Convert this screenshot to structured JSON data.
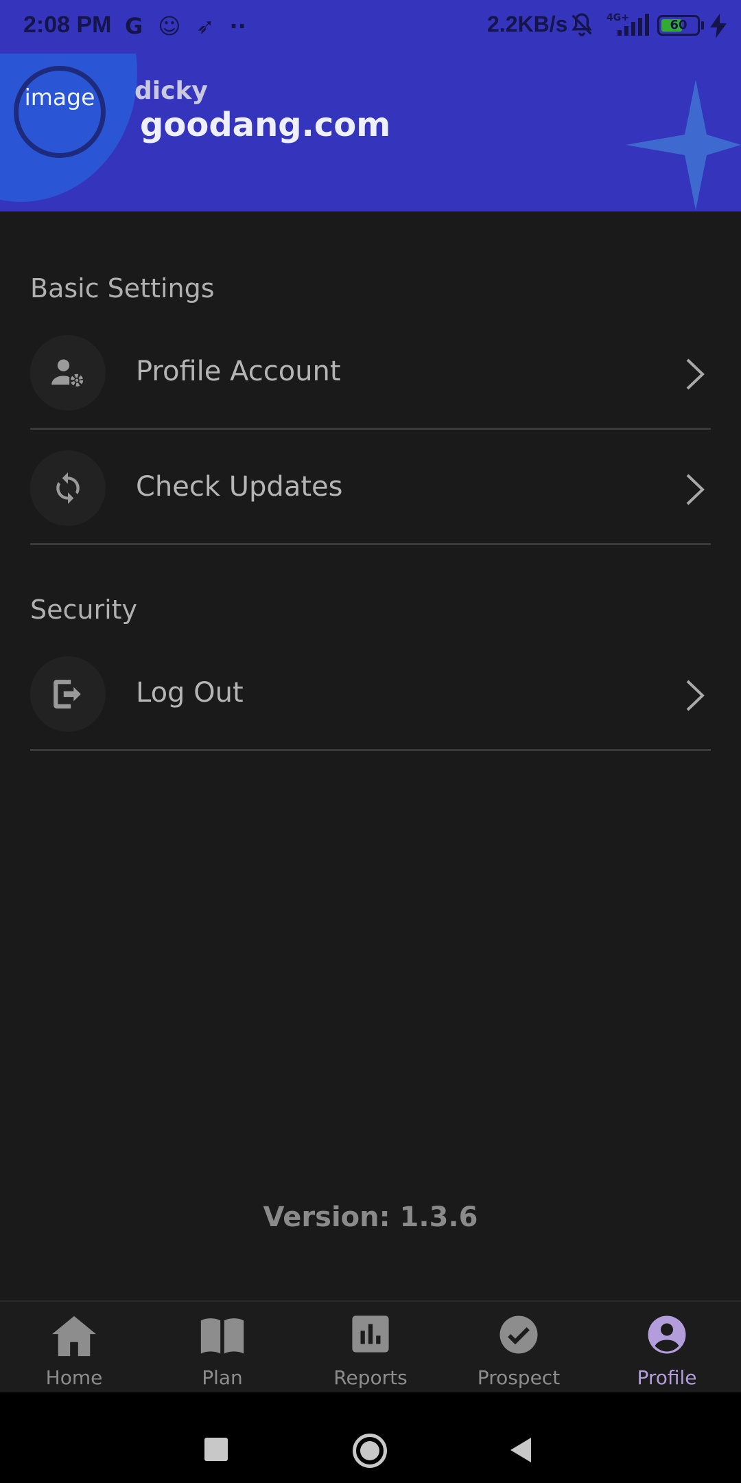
{
  "status_bar": {
    "time": "2:08 PM",
    "icons": [
      "G",
      "☺",
      "➶",
      "··"
    ],
    "net_speed": "2.2KB/s",
    "network_type": "4G+",
    "battery": "60",
    "battery_level": 0.6
  },
  "header": {
    "avatar_alt": "image",
    "username": "dicky",
    "company": "goodang.com"
  },
  "sections": {
    "basic": {
      "title": "Basic Settings",
      "items": [
        {
          "label": "Profile Account",
          "icon": "user-gear-icon"
        },
        {
          "label": "Check Updates",
          "icon": "sync-icon"
        }
      ]
    },
    "security": {
      "title": "Security",
      "items": [
        {
          "label": "Log Out",
          "icon": "logout-icon"
        }
      ]
    }
  },
  "version": "Version: 1.3.6",
  "bottom_nav": {
    "items": [
      {
        "label": "Home",
        "icon": "home-icon"
      },
      {
        "label": "Plan",
        "icon": "book-icon"
      },
      {
        "label": "Reports",
        "icon": "bar-chart-icon"
      },
      {
        "label": "Prospect",
        "icon": "check-circle-icon"
      },
      {
        "label": "Profile",
        "icon": "account-circle-icon",
        "active": true
      }
    ]
  },
  "colors": {
    "header_bg": "#3434bd",
    "page_bg": "#1a1a1a",
    "active_nav": "#b39ddb"
  }
}
